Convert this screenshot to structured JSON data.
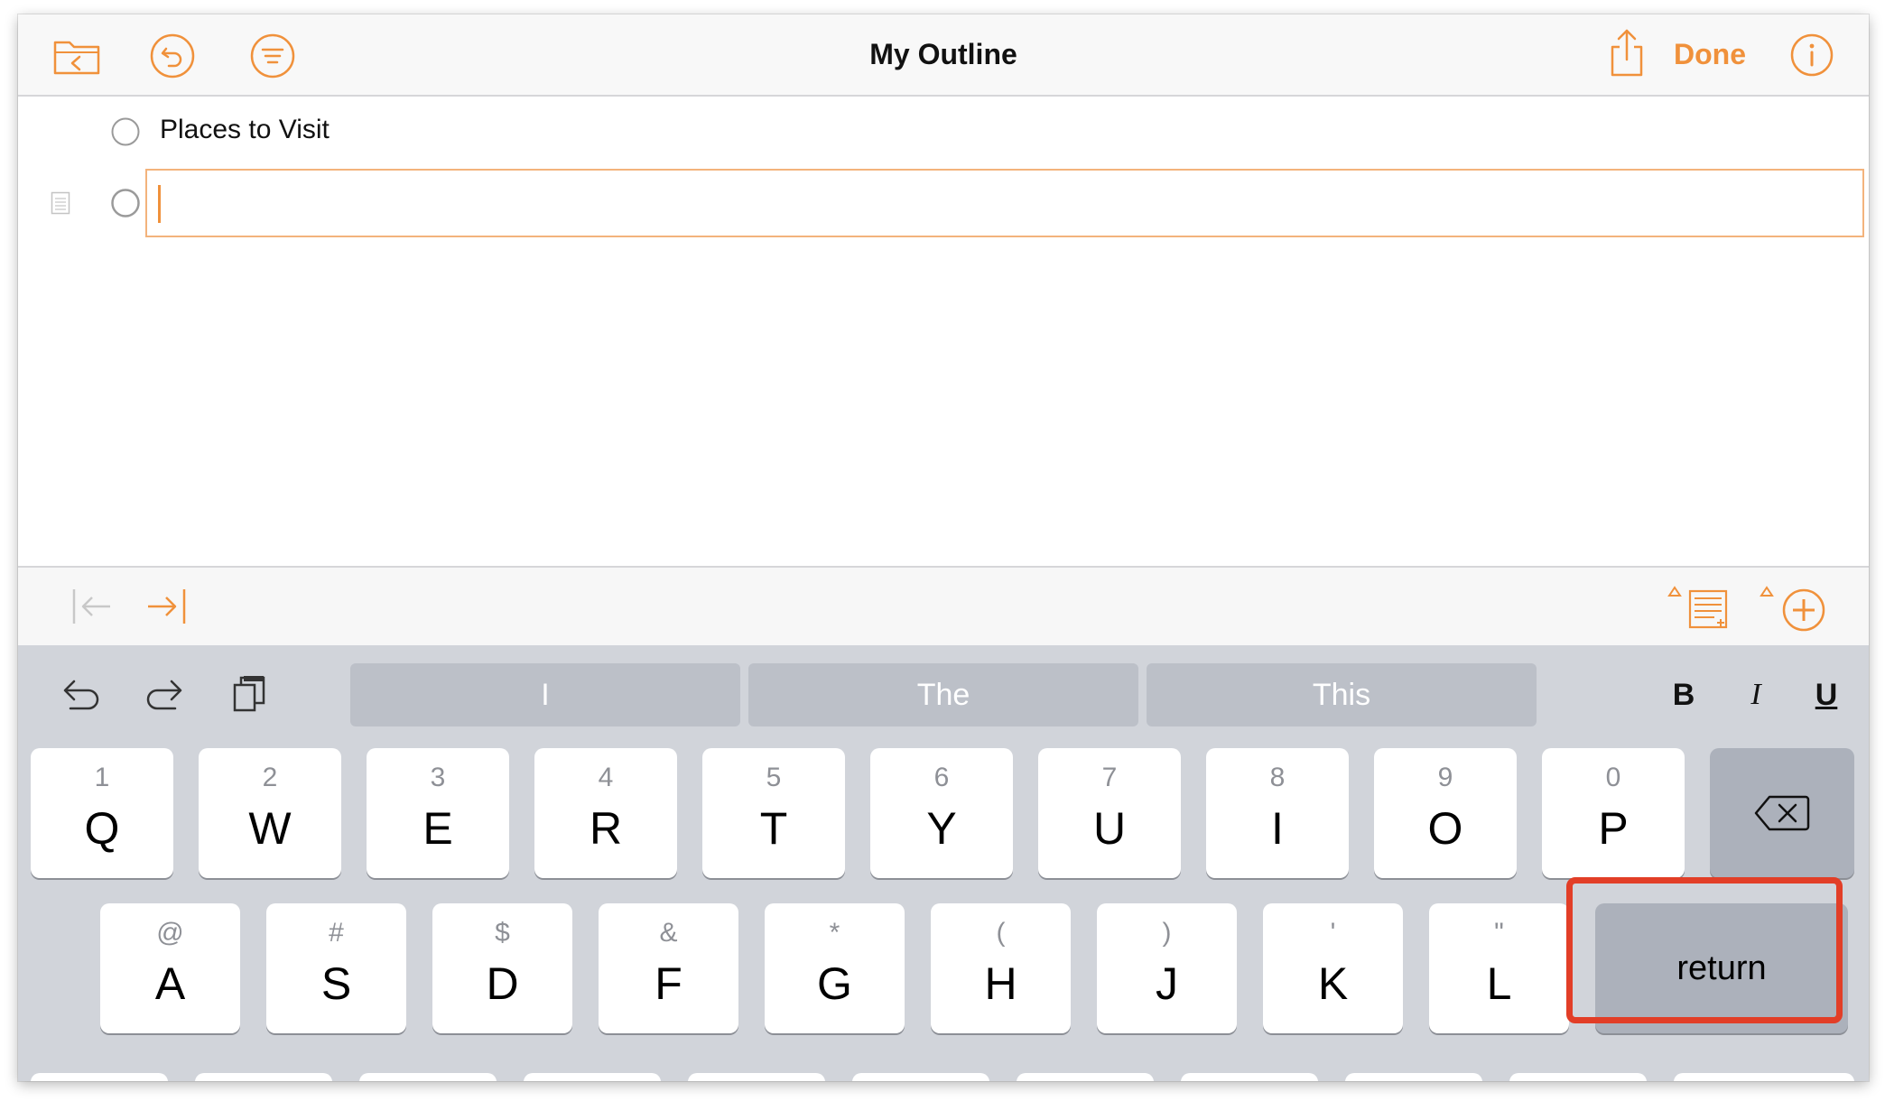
{
  "nav": {
    "title": "My Outline",
    "done_label": "Done"
  },
  "outline": {
    "rows": [
      {
        "text": "Places to Visit",
        "status_icon": "empty-circle-icon"
      },
      {
        "text": "",
        "status_icon": "empty-circle-icon",
        "editing": true
      }
    ]
  },
  "keyboard": {
    "suggestions": [
      "I",
      "The",
      "This"
    ],
    "format": {
      "bold": "B",
      "italic": "I",
      "underline": "U"
    },
    "row1": [
      {
        "hint": "1",
        "key": "Q"
      },
      {
        "hint": "2",
        "key": "W"
      },
      {
        "hint": "3",
        "key": "E"
      },
      {
        "hint": "4",
        "key": "R"
      },
      {
        "hint": "5",
        "key": "T"
      },
      {
        "hint": "6",
        "key": "Y"
      },
      {
        "hint": "7",
        "key": "U"
      },
      {
        "hint": "8",
        "key": "I"
      },
      {
        "hint": "9",
        "key": "O"
      },
      {
        "hint": "0",
        "key": "P"
      }
    ],
    "row2": [
      {
        "hint": "@",
        "key": "A"
      },
      {
        "hint": "#",
        "key": "S"
      },
      {
        "hint": "$",
        "key": "D"
      },
      {
        "hint": "&",
        "key": "F"
      },
      {
        "hint": "*",
        "key": "G"
      },
      {
        "hint": "(",
        "key": "H"
      },
      {
        "hint": ")",
        "key": "J"
      },
      {
        "hint": "'",
        "key": "K"
      },
      {
        "hint": "\"",
        "key": "L"
      }
    ],
    "return_label": "return"
  },
  "colors": {
    "accent": "#f0913b",
    "highlight": "#e23e27",
    "keyboard_bg": "#d1d4da"
  }
}
